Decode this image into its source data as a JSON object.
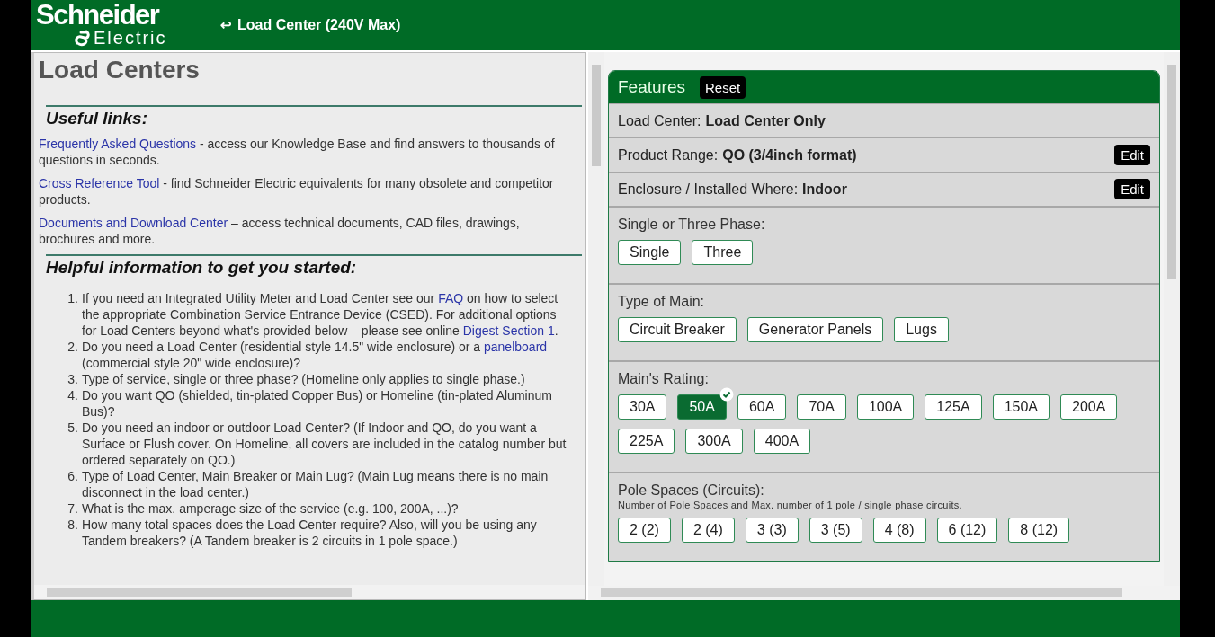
{
  "header": {
    "logo_top": "Schneider",
    "logo_bottom": "Electric",
    "back_glyph": "↩",
    "title": "Load Center (240V Max)"
  },
  "left": {
    "title": "Load Centers",
    "links_heading": "Useful links:",
    "links": [
      {
        "link": "Frequently Asked Questions",
        "text": " - access our Knowledge Base and find answers to thousands of questions in seconds."
      },
      {
        "link": "Cross Reference Tool",
        "text": " - find Schneider Electric equivalents for many obsolete and competitor products."
      },
      {
        "link": "Documents and Download Center",
        "text": " – access technical documents, CAD files, drawings, brochures and more."
      }
    ],
    "help_heading": "Helpful information to get you started:",
    "steps": [
      {
        "number": "1.",
        "parts": [
          {
            "text": "If you need an Integrated Utility Meter and Load Center see our ",
            "kind": "text"
          },
          {
            "text": "FAQ",
            "kind": "link"
          },
          {
            "text": " on how to select the appropriate Combination Service Entrance Device (CSED).  For additional options for Load Centers beyond what's provided below – please see online ",
            "kind": "text"
          },
          {
            "text": "Digest Section 1",
            "kind": "link"
          },
          {
            "text": ".",
            "kind": "text"
          }
        ]
      },
      {
        "number": "2.",
        "parts": [
          {
            "text": "Do you need a Load Center (residential style 14.5\" wide enclosure) or a ",
            "kind": "text"
          },
          {
            "text": "panelboard",
            "kind": "link"
          },
          {
            "text": " (commercial style 20\" wide enclosure)?",
            "kind": "text"
          }
        ]
      },
      {
        "number": "3.",
        "parts": [
          {
            "text": "Type of service, single or three phase? (Homeline only applies to single phase.)",
            "kind": "text"
          }
        ]
      },
      {
        "number": "4.",
        "parts": [
          {
            "text": "Do you want QO (shielded, tin-plated Copper Bus) or Homeline (tin-plated Aluminum Bus)?",
            "kind": "text"
          }
        ]
      },
      {
        "number": "5.",
        "parts": [
          {
            "text": "Do you need an indoor or outdoor Load Center? (If Indoor and QO, do you want a Surface or Flush cover. On Homeline, all covers are included in the catalog number but ordered separately on QO.)",
            "kind": "text"
          }
        ]
      },
      {
        "number": "6.",
        "parts": [
          {
            "text": "Type of Load Center, Main Breaker or Main Lug? (Main Lug means there is no main disconnect in the load center.)",
            "kind": "text"
          }
        ]
      },
      {
        "number": "7.",
        "parts": [
          {
            "text": "What is the max. amperage size of the service (e.g. 100, 200A, ...)?",
            "kind": "text"
          }
        ]
      },
      {
        "number": "8.",
        "parts": [
          {
            "text": "How many total spaces does the Load Center require?  Also, will you be using any Tandem breakers? (A Tandem breaker is 2 circuits in 1 pole space.)",
            "kind": "text"
          }
        ]
      }
    ]
  },
  "features": {
    "title": "Features",
    "reset": "Reset",
    "summary": [
      {
        "label": "Load Center:",
        "value": "Load Center Only"
      },
      {
        "label": "Product Range:",
        "value": "QO (3/4inch format)",
        "edit": "Edit"
      },
      {
        "label": "Enclosure / Installed Where:",
        "value": "Indoor",
        "edit": "Edit"
      }
    ],
    "sections": [
      {
        "title": "Single or Three Phase:",
        "options": [
          {
            "label": "Single",
            "selected": false
          },
          {
            "label": "Three",
            "selected": false
          }
        ]
      },
      {
        "title": "Type of Main:",
        "options": [
          {
            "label": "Circuit Breaker",
            "selected": false
          },
          {
            "label": "Generator Panels",
            "selected": false
          },
          {
            "label": "Lugs",
            "selected": false
          }
        ]
      },
      {
        "title": "Main's Rating:",
        "options": [
          {
            "label": "30A",
            "selected": false
          },
          {
            "label": "50A",
            "selected": true
          },
          {
            "label": "60A",
            "selected": false
          },
          {
            "label": "70A",
            "selected": false
          },
          {
            "label": "100A",
            "selected": false
          },
          {
            "label": "125A",
            "selected": false
          },
          {
            "label": "150A",
            "selected": false
          },
          {
            "label": "200A",
            "selected": false
          },
          {
            "label": "225A",
            "selected": false
          },
          {
            "label": "300A",
            "selected": false
          },
          {
            "label": "400A",
            "selected": false
          }
        ]
      },
      {
        "title": "Pole Spaces (Circuits):",
        "note": "Number of Pole Spaces and Max. number of 1 pole / single phase circuits.",
        "options": [
          {
            "label": "2 (2)",
            "selected": false
          },
          {
            "label": "2 (4)",
            "selected": false
          },
          {
            "label": "3 (3)",
            "selected": false
          },
          {
            "label": "3 (5)",
            "selected": false
          },
          {
            "label": "4 (8)",
            "selected": false
          },
          {
            "label": "6 (12)",
            "selected": false
          },
          {
            "label": "8 (12)",
            "selected": false
          }
        ]
      }
    ]
  }
}
